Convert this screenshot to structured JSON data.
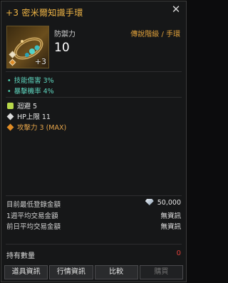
{
  "item": {
    "title": "+3 密米爾知識手環",
    "enhance": "+3",
    "defense_label": "防禦力",
    "defense_value": "10",
    "grade": "傳說階級 / 手環"
  },
  "stats": [
    {
      "label": "技能傷害 3%"
    },
    {
      "label": "暴擊機率 4%"
    }
  ],
  "attributes": {
    "evade": "迴避 5",
    "hp": "HP上限 11",
    "attack": "攻擊力 3 (MAX)"
  },
  "market": {
    "min_price_label": "目前最低登錄金額",
    "min_price_value": "50,000",
    "weekly_avg_label": "1週平均交易金額",
    "weekly_avg_value": "無資訊",
    "prev_day_avg_label": "前日平均交易金額",
    "prev_day_avg_value": "無資訊"
  },
  "holding": {
    "label": "持有數量",
    "value": "0"
  },
  "buttons": {
    "item_info": "道具資訊",
    "market_info": "行情資訊",
    "compare": "比較",
    "buy": "購買"
  },
  "icons": {
    "close": "close-icon",
    "silver": "silver-diamond-icon"
  },
  "colors": {
    "title": "#f0b545",
    "grade": "#e2a23a",
    "stat": "#5fd7c0",
    "attack": "#e6a54a",
    "holding_zero": "#e0403a"
  }
}
